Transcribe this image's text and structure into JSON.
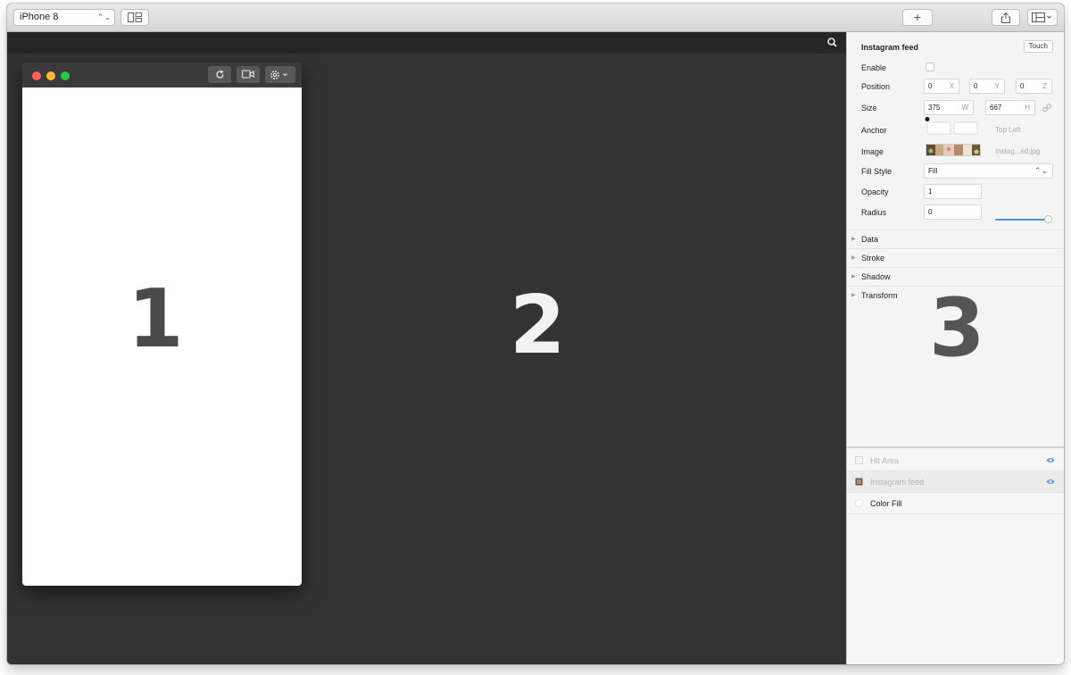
{
  "toolbar": {
    "device_value": "iPhone 8",
    "select_arrows": "⌃⌄",
    "add_symbol": "+"
  },
  "canvas": {
    "label_1": "1",
    "label_2": "2"
  },
  "inspector": {
    "title": "Instagram feed",
    "touch_label": "Touch",
    "label_3": "3",
    "enable_label": "Enable",
    "position_label": "Position",
    "position": {
      "x_value": "0",
      "x_unit": "X",
      "y_value": "0",
      "y_unit": "Y",
      "z_value": "0",
      "z_unit": "Z"
    },
    "size_label": "Size",
    "size": {
      "w_value": "375",
      "w_unit": "W",
      "h_value": "667",
      "h_unit": "H"
    },
    "anchor_label": "Anchor",
    "anchor_value": "Top Left",
    "image_label": "Image",
    "image_file": "Instag...ed.jpg",
    "fill_style_label": "Fill Style",
    "fill_style_value": "Fill",
    "opacity_label": "Opacity",
    "opacity_value": "1",
    "opacity_level": 1.0,
    "radius_label": "Radius",
    "radius_value": "0",
    "sections": [
      "Data",
      "Stroke",
      "Shadow",
      "Transform"
    ]
  },
  "layers": [
    {
      "name": "Hit Area",
      "dimmed": true,
      "visible_icon": "eye-icon"
    },
    {
      "name": "Instagram feed",
      "dimmed": true,
      "selected": true,
      "visible_icon": "eye-icon"
    },
    {
      "name": "Color Fill",
      "dimmed": false
    }
  ],
  "colors": {
    "canvas": "#333333",
    "canvas_bar": "#262626",
    "accent": "#4a90e2",
    "traffic_red": "#fe5f57",
    "traffic_yellow": "#febc2e",
    "traffic_green": "#28c840"
  }
}
